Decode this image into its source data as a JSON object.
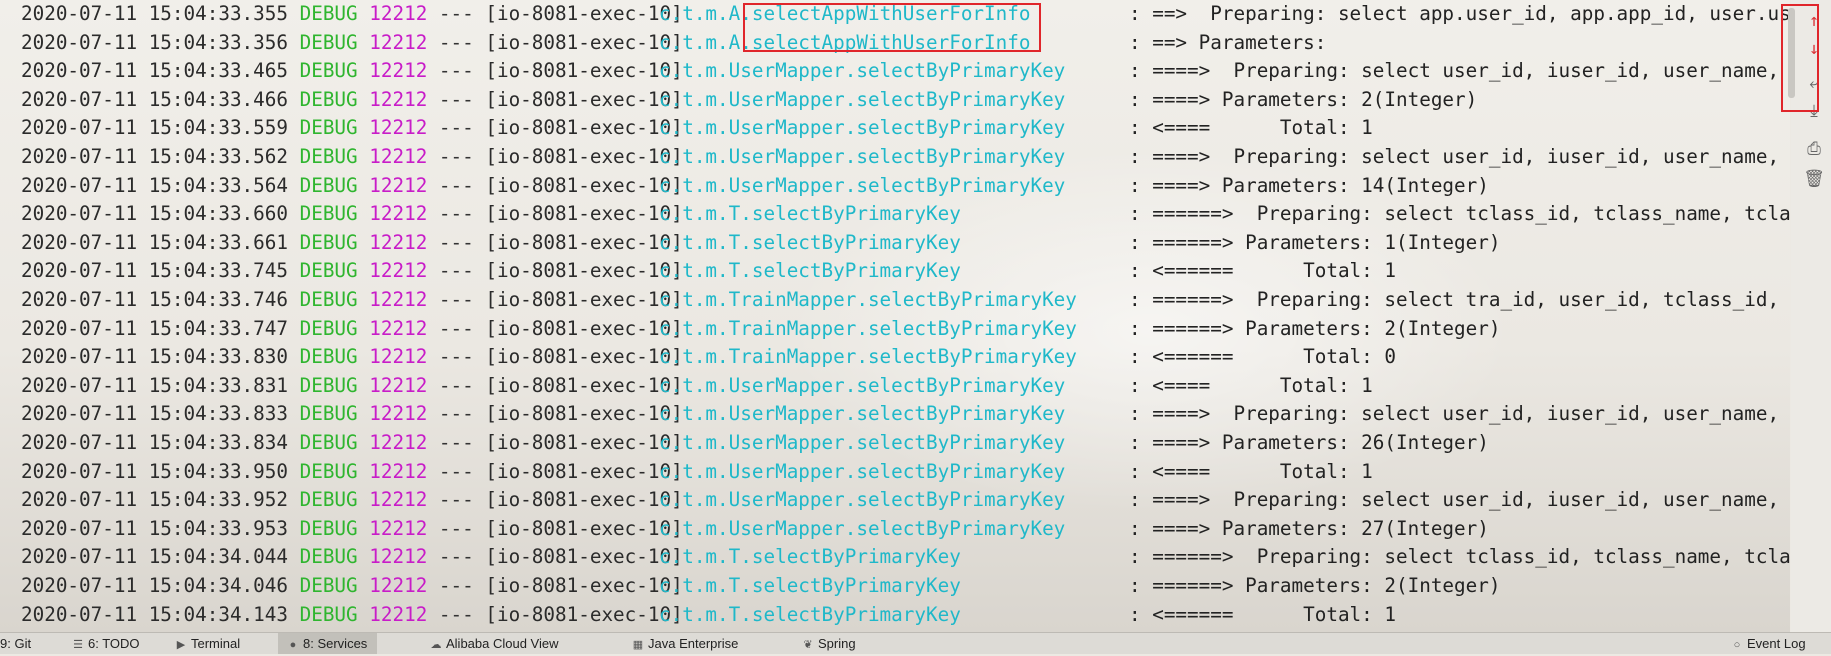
{
  "console": {
    "lines": [
      {
        "timestamp": "2020-07-11 15:04:33.355",
        "level": "DEBUG",
        "pid": "12212",
        "sep": "---",
        "thread": "[io-8081-exec-10]",
        "logger_prefix": "c.t.m.A.",
        "logger_name": "selectAppWithUserForInfo",
        "message": ": ==>  Preparing: select app.user_id, app.app_id, user.user_nam"
      },
      {
        "timestamp": "2020-07-11 15:04:33.356",
        "level": "DEBUG",
        "pid": "12212",
        "sep": "---",
        "thread": "[io-8081-exec-10]",
        "logger_prefix": "c.t.m.A.",
        "logger_name": "selectAppWithUserForInfo",
        "message": ": ==> Parameters:"
      },
      {
        "timestamp": "2020-07-11 15:04:33.465",
        "level": "DEBUG",
        "pid": "12212",
        "sep": "---",
        "thread": "[io-8081-exec-10]",
        "logger_prefix": "",
        "logger_name": "c.t.m.UserMapper.selectByPrimaryKey",
        "message": ": ====>  Preparing: select user_id, iuser_id, user_name, user_c"
      },
      {
        "timestamp": "2020-07-11 15:04:33.466",
        "level": "DEBUG",
        "pid": "12212",
        "sep": "---",
        "thread": "[io-8081-exec-10]",
        "logger_prefix": "",
        "logger_name": "c.t.m.UserMapper.selectByPrimaryKey",
        "message": ": ====> Parameters: 2(Integer)"
      },
      {
        "timestamp": "2020-07-11 15:04:33.559",
        "level": "DEBUG",
        "pid": "12212",
        "sep": "---",
        "thread": "[io-8081-exec-10]",
        "logger_prefix": "",
        "logger_name": "c.t.m.UserMapper.selectByPrimaryKey",
        "message": ": <====      Total: 1"
      },
      {
        "timestamp": "2020-07-11 15:04:33.562",
        "level": "DEBUG",
        "pid": "12212",
        "sep": "---",
        "thread": "[io-8081-exec-10]",
        "logger_prefix": "",
        "logger_name": "c.t.m.UserMapper.selectByPrimaryKey",
        "message": ": ====>  Preparing: select user_id, iuser_id, user_name, user_c"
      },
      {
        "timestamp": "2020-07-11 15:04:33.564",
        "level": "DEBUG",
        "pid": "12212",
        "sep": "---",
        "thread": "[io-8081-exec-10]",
        "logger_prefix": "",
        "logger_name": "c.t.m.UserMapper.selectByPrimaryKey",
        "message": ": ====> Parameters: 14(Integer)"
      },
      {
        "timestamp": "2020-07-11 15:04:33.660",
        "level": "DEBUG",
        "pid": "12212",
        "sep": "---",
        "thread": "[io-8081-exec-10]",
        "logger_prefix": "",
        "logger_name": "c.t.m.T.selectByPrimaryKey",
        "message": ": ======>  Preparing: select tclass_id, tclass_name, tclass_tar"
      },
      {
        "timestamp": "2020-07-11 15:04:33.661",
        "level": "DEBUG",
        "pid": "12212",
        "sep": "---",
        "thread": "[io-8081-exec-10]",
        "logger_prefix": "",
        "logger_name": "c.t.m.T.selectByPrimaryKey",
        "message": ": ======> Parameters: 1(Integer)"
      },
      {
        "timestamp": "2020-07-11 15:04:33.745",
        "level": "DEBUG",
        "pid": "12212",
        "sep": "---",
        "thread": "[io-8081-exec-10]",
        "logger_prefix": "",
        "logger_name": "c.t.m.T.selectByPrimaryKey",
        "message": ": <======      Total: 1"
      },
      {
        "timestamp": "2020-07-11 15:04:33.746",
        "level": "DEBUG",
        "pid": "12212",
        "sep": "---",
        "thread": "[io-8081-exec-10]",
        "logger_prefix": "",
        "logger_name": "c.t.m.TrainMapper.selectByPrimaryKey",
        "message": ": ======>  Preparing: select tra_id, user_id, tclass_id, train_"
      },
      {
        "timestamp": "2020-07-11 15:04:33.747",
        "level": "DEBUG",
        "pid": "12212",
        "sep": "---",
        "thread": "[io-8081-exec-10]",
        "logger_prefix": "",
        "logger_name": "c.t.m.TrainMapper.selectByPrimaryKey",
        "message": ": ======> Parameters: 2(Integer)"
      },
      {
        "timestamp": "2020-07-11 15:04:33.830",
        "level": "DEBUG",
        "pid": "12212",
        "sep": "---",
        "thread": "[io-8081-exec-10]",
        "logger_prefix": "",
        "logger_name": "c.t.m.TrainMapper.selectByPrimaryKey",
        "message": ": <======      Total: 0"
      },
      {
        "timestamp": "2020-07-11 15:04:33.831",
        "level": "DEBUG",
        "pid": "12212",
        "sep": "---",
        "thread": "[io-8081-exec-10]",
        "logger_prefix": "",
        "logger_name": "c.t.m.UserMapper.selectByPrimaryKey",
        "message": ": <====      Total: 1"
      },
      {
        "timestamp": "2020-07-11 15:04:33.833",
        "level": "DEBUG",
        "pid": "12212",
        "sep": "---",
        "thread": "[io-8081-exec-10]",
        "logger_prefix": "",
        "logger_name": "c.t.m.UserMapper.selectByPrimaryKey",
        "message": ": ====>  Preparing: select user_id, iuser_id, user_name, user_c"
      },
      {
        "timestamp": "2020-07-11 15:04:33.834",
        "level": "DEBUG",
        "pid": "12212",
        "sep": "---",
        "thread": "[io-8081-exec-10]",
        "logger_prefix": "",
        "logger_name": "c.t.m.UserMapper.selectByPrimaryKey",
        "message": ": ====> Parameters: 26(Integer)"
      },
      {
        "timestamp": "2020-07-11 15:04:33.950",
        "level": "DEBUG",
        "pid": "12212",
        "sep": "---",
        "thread": "[io-8081-exec-10]",
        "logger_prefix": "",
        "logger_name": "c.t.m.UserMapper.selectByPrimaryKey",
        "message": ": <====      Total: 1"
      },
      {
        "timestamp": "2020-07-11 15:04:33.952",
        "level": "DEBUG",
        "pid": "12212",
        "sep": "---",
        "thread": "[io-8081-exec-10]",
        "logger_prefix": "",
        "logger_name": "c.t.m.UserMapper.selectByPrimaryKey",
        "message": ": ====>  Preparing: select user_id, iuser_id, user_name, user_c"
      },
      {
        "timestamp": "2020-07-11 15:04:33.953",
        "level": "DEBUG",
        "pid": "12212",
        "sep": "---",
        "thread": "[io-8081-exec-10]",
        "logger_prefix": "",
        "logger_name": "c.t.m.UserMapper.selectByPrimaryKey",
        "message": ": ====> Parameters: 27(Integer)"
      },
      {
        "timestamp": "2020-07-11 15:04:34.044",
        "level": "DEBUG",
        "pid": "12212",
        "sep": "---",
        "thread": "[io-8081-exec-10]",
        "logger_prefix": "",
        "logger_name": "c.t.m.T.selectByPrimaryKey",
        "message": ": ======>  Preparing: select tclass_id, tclass_name, tclass_tar"
      },
      {
        "timestamp": "2020-07-11 15:04:34.046",
        "level": "DEBUG",
        "pid": "12212",
        "sep": "---",
        "thread": "[io-8081-exec-10]",
        "logger_prefix": "",
        "logger_name": "c.t.m.T.selectByPrimaryKey",
        "message": ": ======> Parameters: 2(Integer)"
      },
      {
        "timestamp": "2020-07-11 15:04:34.143",
        "level": "DEBUG",
        "pid": "12212",
        "sep": "---",
        "thread": "[io-8081-exec-10]",
        "logger_prefix": "",
        "logger_name": "c.t.m.T.selectByPrimaryKey",
        "message": ": <======      Total: 1"
      }
    ]
  },
  "right_toolbar": {
    "icons": [
      "up-arrow-icon",
      "down-arrow-icon",
      "soft-wrap-icon",
      "scroll-to-end-icon",
      "print-icon",
      "trash-icon"
    ]
  },
  "bottom_bar": {
    "tabs": [
      {
        "label": "9: Git",
        "icon": "git-icon"
      },
      {
        "label": "6: TODO",
        "icon": "todo-list-icon"
      },
      {
        "label": "Terminal",
        "icon": "terminal-icon"
      },
      {
        "label": "8: Services",
        "icon": "services-icon",
        "active": true
      },
      {
        "label": "Alibaba Cloud View",
        "icon": "cloud-icon"
      },
      {
        "label": "Java Enterprise",
        "icon": "java-enterprise-icon"
      },
      {
        "label": "Spring",
        "icon": "spring-leaf-icon"
      }
    ],
    "event_log": "Event Log"
  },
  "colors": {
    "timestamp": "#2b2b2b",
    "level_debug": "#2fb52f",
    "pid": "#c81cc8",
    "logger": "#1fb8c9",
    "highlight_box": "#e0262b"
  }
}
